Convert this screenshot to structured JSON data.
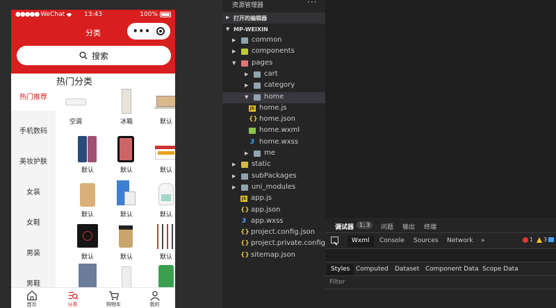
{
  "phone": {
    "status": {
      "carrier": "WeChat",
      "time": "13:43",
      "battery": "100%"
    },
    "nav_title": "分类",
    "search_label": "搜索",
    "category_title": "热门分类",
    "categories": [
      "热门推荐",
      "手机数码",
      "美妆护肤",
      "女装",
      "女鞋",
      "男装",
      "男鞋"
    ],
    "active_category": "热门推荐",
    "products": [
      "空调",
      "冰箱",
      "默认",
      "默认",
      "默认",
      "默认",
      "默认",
      "默认",
      "默认",
      "默认",
      "默认",
      "默认",
      "",
      "",
      ""
    ],
    "tabs": [
      "首页",
      "分类",
      "购物车",
      "我的"
    ],
    "active_tab": "分类",
    "accent_color": "#d81e1e"
  },
  "explorer": {
    "title": "资源管理器",
    "open_editors": "打开的编辑器",
    "project": "MP-WEIXIN",
    "tree": [
      {
        "label": "common",
        "type": "folder",
        "depth": 1,
        "expanded": false
      },
      {
        "label": "components",
        "type": "folder",
        "depth": 1,
        "expanded": false
      },
      {
        "label": "pages",
        "type": "folder",
        "depth": 1,
        "expanded": true
      },
      {
        "label": "cart",
        "type": "folder",
        "depth": 2,
        "expanded": false
      },
      {
        "label": "category",
        "type": "folder",
        "depth": 2,
        "expanded": false
      },
      {
        "label": "home",
        "type": "folder",
        "depth": 2,
        "expanded": true,
        "selected": true
      },
      {
        "label": "home.js",
        "type": "js",
        "depth": 3
      },
      {
        "label": "home.json",
        "type": "json",
        "depth": 3
      },
      {
        "label": "home.wxml",
        "type": "wxml",
        "depth": 3
      },
      {
        "label": "home.wxss",
        "type": "wxss",
        "depth": 3
      },
      {
        "label": "me",
        "type": "folder",
        "depth": 2,
        "expanded": false
      },
      {
        "label": "static",
        "type": "folder",
        "depth": 1,
        "expanded": false
      },
      {
        "label": "subPackages",
        "type": "folder",
        "depth": 1,
        "expanded": false
      },
      {
        "label": "uni_modules",
        "type": "folder",
        "depth": 1,
        "expanded": false
      },
      {
        "label": "app.js",
        "type": "js",
        "depth": 1
      },
      {
        "label": "app.json",
        "type": "json",
        "depth": 1
      },
      {
        "label": "app.wxss",
        "type": "wxss",
        "depth": 1
      },
      {
        "label": "project.config.json",
        "type": "json",
        "depth": 1
      },
      {
        "label": "project.private.config.js...",
        "type": "json",
        "depth": 1
      },
      {
        "label": "sitemap.json",
        "type": "json",
        "depth": 1
      }
    ]
  },
  "debugger": {
    "top_tabs": [
      "调试器",
      "问题",
      "输出",
      "终端"
    ],
    "badge": "1, 3",
    "panel_tabs": [
      "Wxml",
      "Console",
      "Sources",
      "Network"
    ],
    "more": "»",
    "errors": "1",
    "warnings": "3",
    "sub_tabs": [
      "Styles",
      "Computed",
      "Dataset",
      "Component Data",
      "Scope Data"
    ],
    "filter_placeholder": "Filter"
  }
}
